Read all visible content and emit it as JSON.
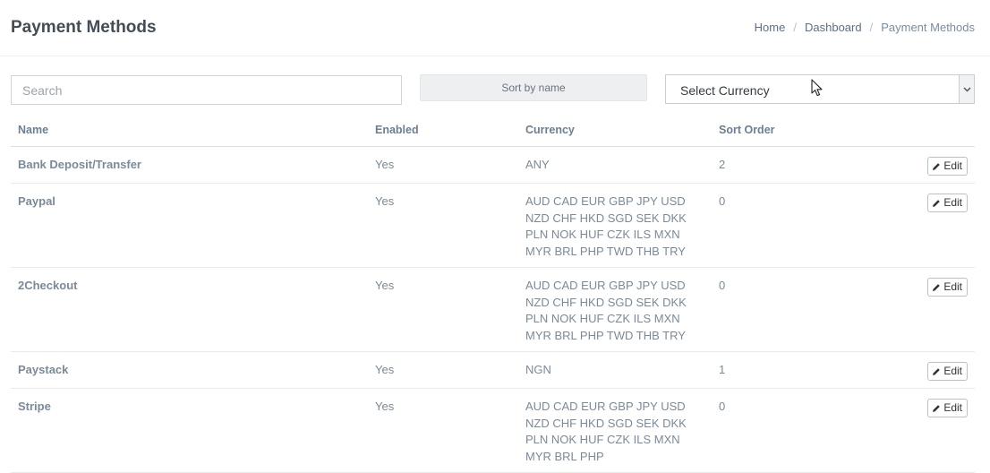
{
  "header": {
    "title": "Payment Methods",
    "breadcrumb": [
      "Home",
      "Dashboard",
      "Payment Methods"
    ]
  },
  "toolbar": {
    "search_placeholder": "Search",
    "sort_label": "Sort by name",
    "currency_select_value": "Select Currency"
  },
  "table": {
    "columns": [
      "Name",
      "Enabled",
      "Currency",
      "Sort Order"
    ],
    "edit_label": "Edit",
    "rows": [
      {
        "name": "Bank Deposit/Transfer",
        "enabled": "Yes",
        "currency": "ANY",
        "sort_order": "2"
      },
      {
        "name": "Paypal",
        "enabled": "Yes",
        "currency": "AUD CAD EUR GBP JPY USD NZD CHF HKD SGD SEK DKK PLN NOK HUF CZK ILS MXN MYR BRL PHP TWD THB TRY",
        "sort_order": "0"
      },
      {
        "name": "2Checkout",
        "enabled": "Yes",
        "currency": "AUD CAD EUR GBP JPY USD NZD CHF HKD SGD SEK DKK PLN NOK HUF CZK ILS MXN MYR BRL PHP TWD THB TRY",
        "sort_order": "0"
      },
      {
        "name": "Paystack",
        "enabled": "Yes",
        "currency": "NGN",
        "sort_order": "1"
      },
      {
        "name": "Stripe",
        "enabled": "Yes",
        "currency": "AUD CAD EUR GBP JPY USD NZD CHF HKD SGD SEK DKK PLN NOK HUF CZK ILS MXN MYR BRL PHP",
        "sort_order": "0"
      }
    ]
  },
  "icons": {
    "edit": "pencil-icon",
    "select": "chevron-down-icon",
    "cursor": "mouse-pointer-icon"
  }
}
